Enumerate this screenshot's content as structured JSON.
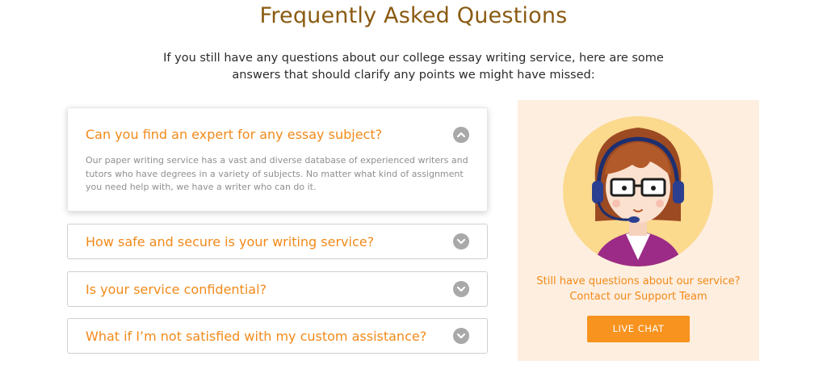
{
  "header": {
    "title": "Frequently Asked Questions",
    "subtitle": "If you still have any questions about our college essay writing service, here are some answers that should clarify any points we might have missed:"
  },
  "faq": [
    {
      "question": "Can you find an expert for any essay subject?",
      "answer": "Our paper writing service has a vast and diverse database of experienced writers and tutors who have degrees in a variety of subjects. No matter what kind of assignment you need help with, we have a writer who can do it.",
      "expanded": true
    },
    {
      "question": "How safe and secure is your writing service?",
      "expanded": false
    },
    {
      "question": "Is your service confidential?",
      "expanded": false
    },
    {
      "question": "What if I’m not satisfied with my custom assistance?",
      "expanded": false
    }
  ],
  "support": {
    "line1": "Still have questions about our service?",
    "line2": "Contact our Support Team",
    "button_label": "LIVE CHAT"
  },
  "colors": {
    "accent": "#f28a1a",
    "title": "#8a5a12",
    "panel_bg": "#fdeedf",
    "button_bg": "#f7931e"
  }
}
